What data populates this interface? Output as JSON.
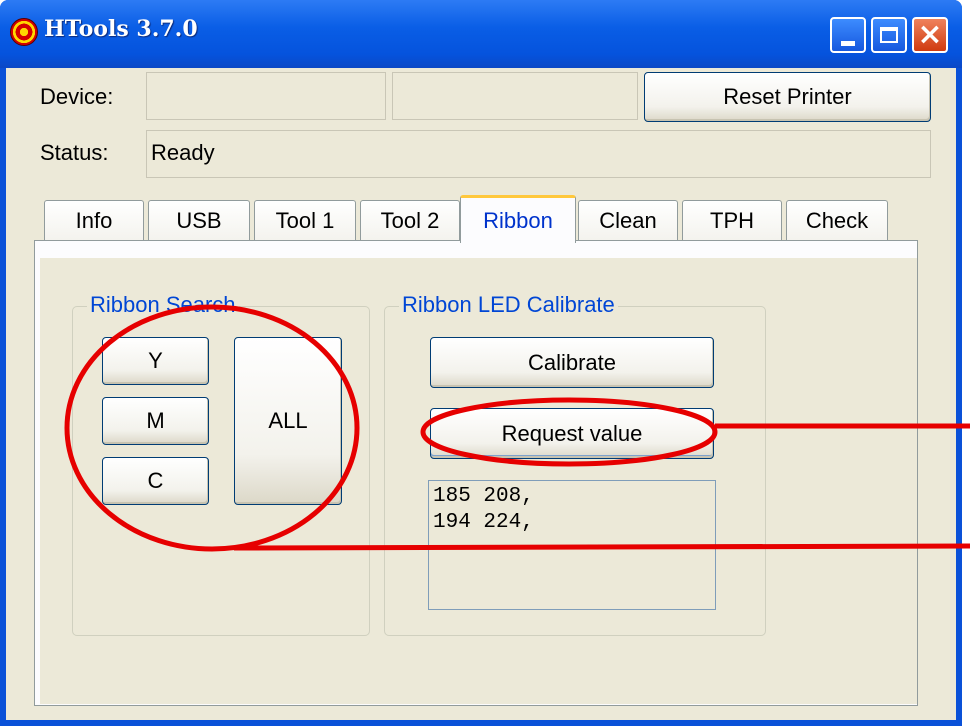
{
  "window": {
    "title": "HTools  3.7.0",
    "icon": "app-target-icon",
    "controls": {
      "minimize": "minimize-icon",
      "maximize": "maximize-icon",
      "close": "×"
    }
  },
  "device": {
    "label": "Device:",
    "field1_value": "",
    "field2_value": "",
    "reset_button": "Reset Printer"
  },
  "status": {
    "label": "Status:",
    "value": "Ready"
  },
  "tabs": [
    {
      "label": "Info"
    },
    {
      "label": "USB"
    },
    {
      "label": "Tool 1"
    },
    {
      "label": "Tool 2"
    },
    {
      "label": "Ribbon",
      "active": true
    },
    {
      "label": "Clean"
    },
    {
      "label": "TPH"
    },
    {
      "label": "Check"
    }
  ],
  "ribbon_search": {
    "title": "Ribbon Search",
    "buttons": {
      "y": "Y",
      "m": "M",
      "c": "C",
      "all": "ALL"
    }
  },
  "ribbon_led": {
    "title": "Ribbon LED Calibrate",
    "calibrate_button": "Calibrate",
    "request_button": "Request value",
    "output_lines": [
      "185  208,",
      "194  224,"
    ]
  },
  "colors": {
    "accent": "#0046d5",
    "annotation": "#e60000",
    "titlebar": "#0553dd",
    "face": "#ece9d8"
  }
}
